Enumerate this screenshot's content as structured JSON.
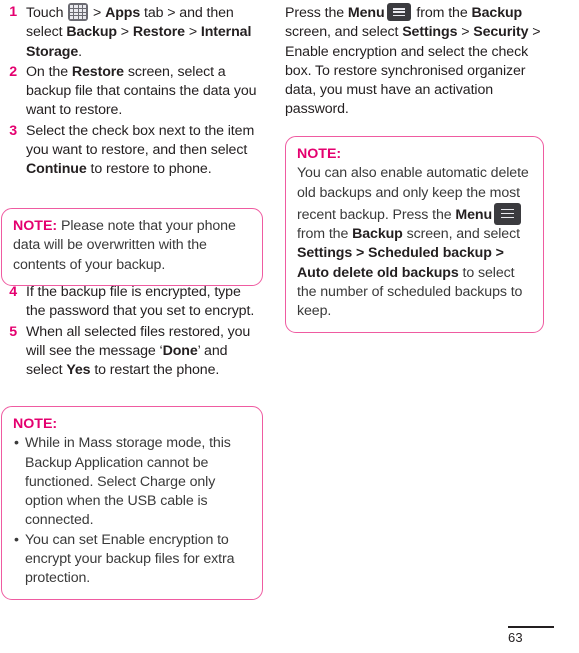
{
  "colors": {
    "accent_pink": "#e4006f",
    "note_border": "#ef5ba1",
    "body_text": "#231f20",
    "icon_apps_bg": "#6b6b72",
    "icon_menu_bg": "#3b3b3f"
  },
  "icons": {
    "apps_grid": "apps-grid-icon",
    "menu": "menu-icon"
  },
  "left_column": {
    "steps_group_a": [
      {
        "number": "1",
        "segments": [
          {
            "text": "Touch ",
            "bold": false
          },
          {
            "icon": "apps-grid-icon"
          },
          {
            "text": " > ",
            "bold": false
          },
          {
            "text": "Apps",
            "bold": true
          },
          {
            "text": " tab > and then select ",
            "bold": false
          },
          {
            "text": "Backup",
            "bold": true
          },
          {
            "text": " > ",
            "bold": false
          },
          {
            "text": "Restore",
            "bold": true
          },
          {
            "text": " > ",
            "bold": false
          },
          {
            "text": "Internal Storage",
            "bold": true
          },
          {
            "text": ".",
            "bold": false
          }
        ]
      },
      {
        "number": "2",
        "segments": [
          {
            "text": "On the ",
            "bold": false
          },
          {
            "text": "Restore",
            "bold": true
          },
          {
            "text": " screen, select a backup file that contains the data you want to restore.",
            "bold": false
          }
        ]
      },
      {
        "number": "3",
        "segments": [
          {
            "text": "Select the check box next to the item you want to restore, and then select ",
            "bold": false
          },
          {
            "text": "Continue",
            "bold": true
          },
          {
            "text": " to restore to phone.",
            "bold": false
          }
        ]
      }
    ],
    "note_1": {
      "label": "NOTE:",
      "segments": [
        {
          "text": " Please note that your phone data will be overwritten with the contents of your backup.",
          "bold": false
        }
      ]
    },
    "steps_group_b": [
      {
        "number": "4",
        "segments": [
          {
            "text": "If the backup file is encrypted, type the password that you set to encrypt.",
            "bold": false
          }
        ]
      },
      {
        "number": "5",
        "segments": [
          {
            "text": "When all selected files restored, you will see the message ‘",
            "bold": false
          },
          {
            "text": "Done",
            "bold": true
          },
          {
            "text": "’ and select ",
            "bold": false
          },
          {
            "text": "Yes",
            "bold": true
          },
          {
            "text": " to restart the phone.",
            "bold": false
          }
        ]
      }
    ],
    "note_2": {
      "label": "NOTE:",
      "bullets": [
        {
          "segments": [
            {
              "text": "While in Mass storage mode, this Backup Application cannot be functioned. Select Charge only option when the USB cable is connected.",
              "bold": false
            }
          ]
        },
        {
          "segments": [
            {
              "text": "You can set Enable encryption to encrypt your backup files for extra protection.",
              "bold": false
            }
          ]
        }
      ]
    }
  },
  "right_column": {
    "paragraph": {
      "segments": [
        {
          "text": "Press the ",
          "bold": false
        },
        {
          "text": "Menu",
          "bold": true
        },
        {
          "icon": "menu-icon"
        },
        {
          "text": " from the ",
          "bold": false
        },
        {
          "text": "Backup",
          "bold": true
        },
        {
          "text": " screen, and select ",
          "bold": false
        },
        {
          "text": "Settings",
          "bold": true
        },
        {
          "text": " > ",
          "bold": false
        },
        {
          "text": "Security",
          "bold": true
        },
        {
          "text": " > Enable encryption and select the check box. To restore synchronised organizer data, you must have an activation password.",
          "bold": false
        }
      ]
    },
    "note_3": {
      "label": "NOTE:",
      "segments": [
        {
          "text": "You can also enable automatic delete old backups and only keep the most recent backup. Press the ",
          "bold": false
        },
        {
          "text": "Menu",
          "bold": true
        },
        {
          "icon": "menu-icon-big"
        },
        {
          "text": " from the ",
          "bold": false
        },
        {
          "text": "Backup",
          "bold": true
        },
        {
          "text": " screen, and select ",
          "bold": false
        },
        {
          "text": "Settings > Scheduled backup > Auto delete old backups",
          "bold": true
        },
        {
          "text": " to select the number of scheduled backups to keep.",
          "bold": false
        }
      ]
    }
  },
  "footer": {
    "page_number": "63"
  }
}
